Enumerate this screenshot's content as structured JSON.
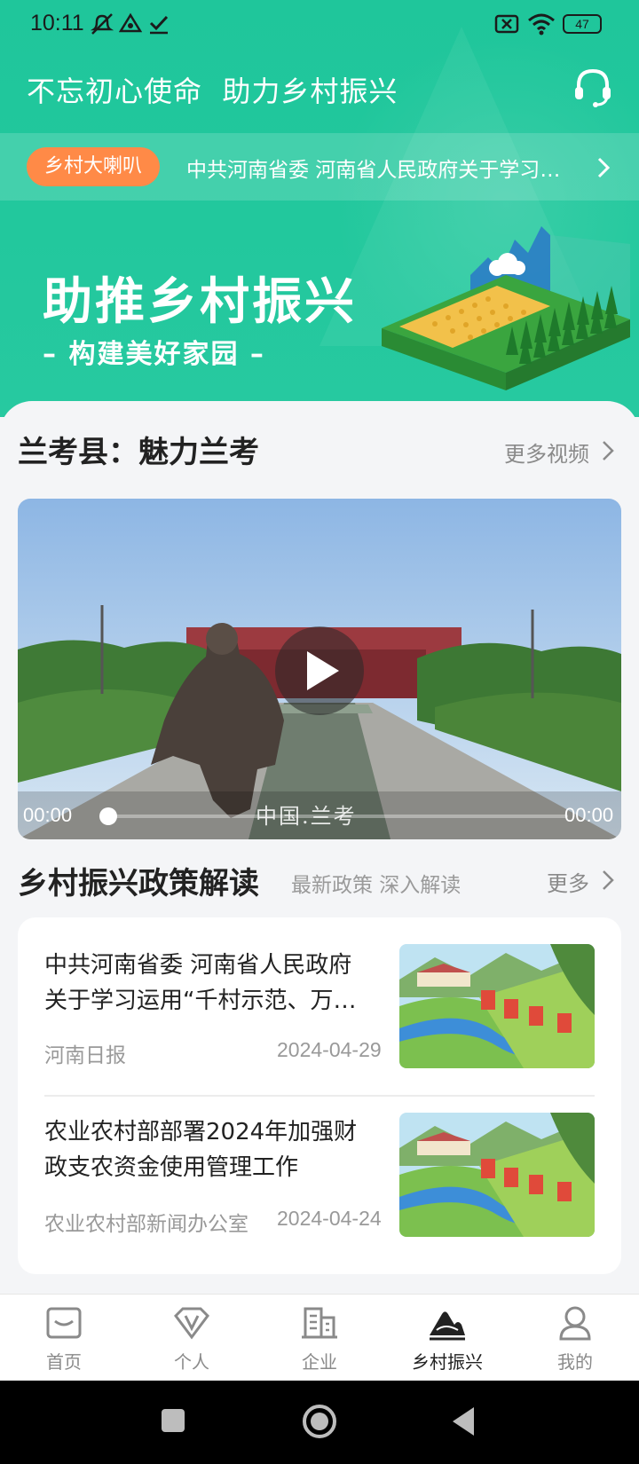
{
  "status_bar": {
    "time": "10:11",
    "battery": "47"
  },
  "header": {
    "slogan": "不忘初心使命  助力乡村振兴",
    "notice": {
      "tag": "乡村大喇叭",
      "text": "中共河南省委 河南省人民政府关于学习运用“千村示范、万村整治”工程经验"
    },
    "banner": {
      "title": "助推乡村振兴",
      "subtitle": "– 构建美好家园 –"
    }
  },
  "video_section": {
    "title": "兰考县：魅力兰考",
    "more": "更多视频",
    "player": {
      "current_time": "00:00",
      "duration": "00:00",
      "caption": "中国.兰考",
      "progress": 0
    }
  },
  "policy_section": {
    "title": "乡村振兴政策解读",
    "subtitle": "最新政策 深入解读",
    "more": "更多",
    "items": [
      {
        "title": "中共河南省委 河南省人民政府关于学习运用“千村示范、万村整治”工程经验",
        "source": "河南日报",
        "date": "2024-04-29"
      },
      {
        "title": "农业农村部部署2024年加强财政支农资金使用管理工作",
        "source": "农业农村部新闻办公室",
        "date": "2024-04-24"
      }
    ]
  },
  "tabbar": {
    "items": [
      {
        "label": "首页",
        "icon": "home-icon"
      },
      {
        "label": "个人",
        "icon": "personal-v-icon"
      },
      {
        "label": "企业",
        "icon": "building-icon"
      },
      {
        "label": "乡村振兴",
        "icon": "mountain-icon"
      },
      {
        "label": "我的",
        "icon": "user-icon"
      }
    ],
    "active_index": 3
  },
  "colors": {
    "primary": "#22c89d",
    "tag": "#ff8a47",
    "text": "#222222",
    "muted": "#8a8a8a"
  }
}
